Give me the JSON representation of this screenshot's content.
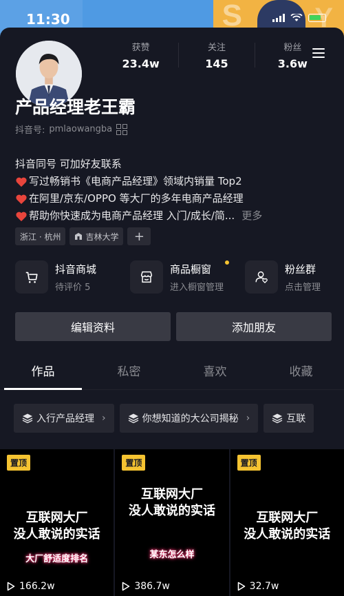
{
  "status": {
    "time": "11:30"
  },
  "profile": {
    "name": "产品经理老王霸",
    "douyin_id_label": "抖音号:",
    "douyin_id": "pmlaowangba",
    "stats": [
      {
        "label": "获赞",
        "value": "23.4w"
      },
      {
        "label": "关注",
        "value": "145"
      },
      {
        "label": "粉丝",
        "value": "3.6w"
      }
    ],
    "bio": [
      "抖音同号 可加好友联系",
      "写过畅销书《电商产品经理》领域内销量 Top2",
      "在阿里/京东/OPPO 等大厂的多年电商产品经理",
      "帮助你快速成为电商产品经理 入门/成长/简..."
    ],
    "bio_more": "更多",
    "tags": {
      "location": "浙江 · 杭州",
      "school": "吉林大学",
      "add": "+"
    }
  },
  "services": [
    {
      "title": "抖音商城",
      "sub": "待评价 5",
      "icon": "cart-icon"
    },
    {
      "title": "商品橱窗",
      "sub": "进入橱窗管理",
      "icon": "shop-window-icon"
    },
    {
      "title": "粉丝群",
      "sub": "点击管理",
      "icon": "fan-group-icon"
    }
  ],
  "actions": {
    "edit": "编辑资料",
    "add_friend": "添加朋友"
  },
  "tabs": [
    "作品",
    "私密",
    "喜欢",
    "收藏"
  ],
  "collections": [
    "入行产品经理",
    "你想知道的大公司揭秘",
    "互联"
  ],
  "videos": [
    {
      "pin": "置顶",
      "title_1": "互联网大厂",
      "title_2": "没人敢说的实话",
      "sub": "大厂舒适度排名",
      "views": "166.2w"
    },
    {
      "pin": "置顶",
      "title_1": "互联网大厂",
      "title_2": "没人敢说的实话",
      "sub": "某东怎么样",
      "views": "386.7w"
    },
    {
      "pin": "置顶",
      "title_1": "互联网大厂",
      "title_2": "没人敢说的实话",
      "sub": "",
      "views": "32.7w"
    }
  ],
  "colors": {
    "background": "#161823",
    "pin": "#f5c331",
    "bio_heart": "#e8453c",
    "cover_blue": "#4f9ae3",
    "cover_yellow": "#f2b343"
  }
}
